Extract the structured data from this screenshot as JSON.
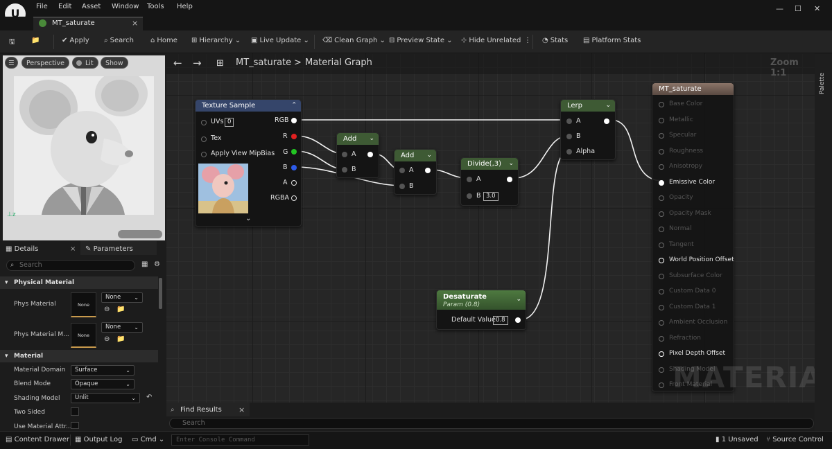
{
  "menu": {
    "items": [
      "File",
      "Edit",
      "Asset",
      "Window",
      "Tools",
      "Help"
    ]
  },
  "tab": {
    "title": "MT_saturate",
    "close": "×"
  },
  "toolbar": {
    "apply": "Apply",
    "search": "Search",
    "home": "Home",
    "hierarchy": "Hierarchy",
    "live_update": "Live Update",
    "clean_graph": "Clean Graph",
    "preview_state": "Preview State",
    "hide_unrelated": "Hide Unrelated",
    "stats": "Stats",
    "platform_stats": "Platform Stats"
  },
  "viewport": {
    "perspective": "Perspective",
    "lit": "Lit",
    "show": "Show"
  },
  "details": {
    "tab_details": "Details",
    "tab_parameters": "Parameters",
    "search_placeholder": "Search",
    "sections": {
      "physical_material": "Physical Material",
      "material": "Material"
    },
    "phys_material": {
      "label": "Phys Material",
      "value": "None",
      "thumb": "None"
    },
    "phys_material_map": {
      "label": "Phys Material M...",
      "value": "None",
      "thumb": "None"
    },
    "material_domain": {
      "label": "Material Domain",
      "value": "Surface"
    },
    "blend_mode": {
      "label": "Blend Mode",
      "value": "Opaque"
    },
    "shading_model": {
      "label": "Shading Model",
      "value": "Unlit"
    },
    "two_sided": {
      "label": "Two Sided"
    },
    "use_material_attr": {
      "label": "Use Material Attr..."
    }
  },
  "graph": {
    "breadcrumb_asset": "MT_saturate",
    "breadcrumb_sep": ">",
    "breadcrumb_graph": "Material Graph",
    "zoom": "Zoom 1:1",
    "palette": "Palette",
    "watermark": "MATERIAL",
    "texture_sample": {
      "title": "Texture Sample",
      "uvs": "UVs",
      "uvs_value": "0",
      "tex": "Tex",
      "apply_mipbias": "Apply View MipBias",
      "rgb": "RGB",
      "r": "R",
      "g": "G",
      "b": "B",
      "a": "A",
      "rgba": "RGBA"
    },
    "add1": {
      "title": "Add",
      "a": "A",
      "b": "B"
    },
    "add2": {
      "title": "Add",
      "a": "A",
      "b": "B"
    },
    "divide": {
      "title": "Divide(,3)",
      "a": "A",
      "b": "B",
      "b_value": "3.0"
    },
    "lerp": {
      "title": "Lerp",
      "a": "A",
      "b": "B",
      "alpha": "Alpha"
    },
    "desaturate": {
      "title": "Desaturate",
      "subtitle": "Param (0.8)",
      "default_label": "Default Value",
      "default_value": "0.8"
    },
    "material_node": {
      "title": "MT_saturate",
      "inputs": [
        "Base Color",
        "Metallic",
        "Specular",
        "Roughness",
        "Anisotropy",
        "Emissive Color",
        "Opacity",
        "Opacity Mask",
        "Normal",
        "Tangent",
        "World Position Offset",
        "Subsurface Color",
        "Custom Data 0",
        "Custom Data 1",
        "Ambient Occlusion",
        "Refraction",
        "Pixel Depth Offset",
        "Shading Model",
        "Front Material"
      ],
      "active": [
        5,
        10,
        16
      ]
    },
    "colors": {
      "r": "#e02020",
      "g": "#22c422",
      "b": "#2d5be8",
      "node_header": "#35456a",
      "add_header": "#3e5a34",
      "material_header": "#6e5a50"
    }
  },
  "find_results": {
    "title": "Find Results",
    "close": "×",
    "search_placeholder": "Search"
  },
  "status": {
    "content_drawer": "Content Drawer",
    "output_log": "Output Log",
    "cmd": "Cmd",
    "console_placeholder": "Enter Console Command",
    "unsaved": "1 Unsaved",
    "source_control": "Source Control"
  }
}
